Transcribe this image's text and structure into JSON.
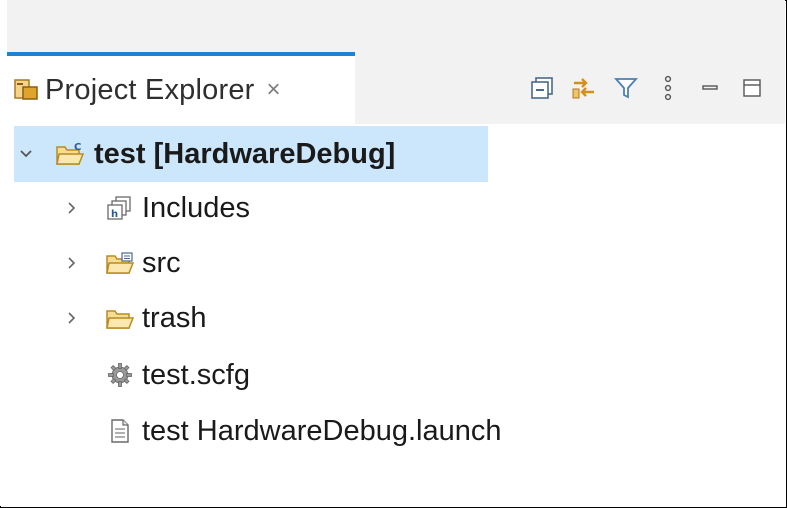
{
  "view": {
    "title": "Project Explorer",
    "close_glyph": "×",
    "toolbar_icons": [
      "collapse-all-icon",
      "link-with-editor-icon",
      "filter-icon",
      "view-menu-icon",
      "minimize-icon",
      "maximize-icon"
    ]
  },
  "tree": {
    "root": {
      "label": "test [HardwareDebug]",
      "expanded": true
    },
    "children": [
      {
        "label": "Includes",
        "icon": "includes-icon",
        "expandable": true
      },
      {
        "label": "src",
        "icon": "source-folder-icon",
        "expandable": true
      },
      {
        "label": "trash",
        "icon": "folder-icon",
        "expandable": true
      },
      {
        "label": "test.scfg",
        "icon": "config-file-icon",
        "expandable": false
      },
      {
        "label": "test HardwareDebug.launch",
        "icon": "launch-file-icon",
        "expandable": false
      }
    ]
  },
  "colors": {
    "accent": "#1c82d4",
    "selection": "#cce6fb",
    "folder": "#e8b040"
  }
}
